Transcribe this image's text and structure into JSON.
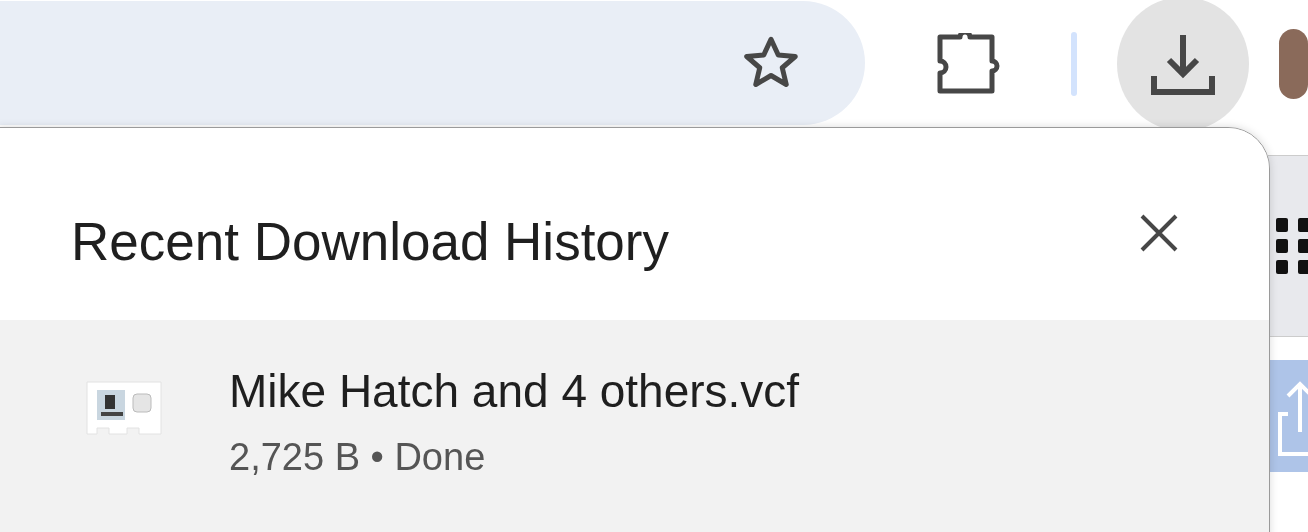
{
  "toolbar": {
    "downloads_active": true
  },
  "popup": {
    "title": "Recent Download History",
    "downloads": [
      {
        "name": "Mike Hatch and 4 others.vcf",
        "detail": "2,725 B • Done"
      }
    ]
  }
}
